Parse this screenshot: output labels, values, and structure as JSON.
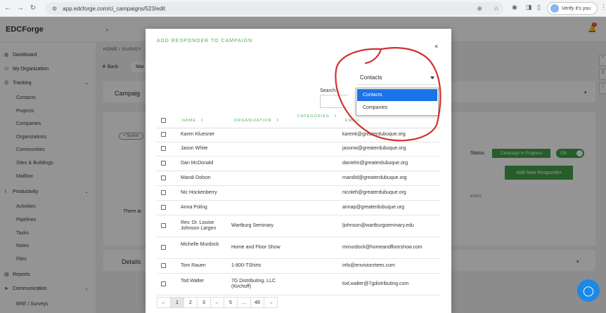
{
  "browser": {
    "url": "app.edcforge.com/ci_campaigns/523/edit",
    "verify_label": "Verify it's you"
  },
  "app": {
    "logo_main": "EDC",
    "logo_sub": "Forge",
    "notif_count": "3",
    "breadcrumb": "HOME / SURVEY",
    "back_label": "Back",
    "main_tab": "Mai",
    "campaign_title": "Campaig",
    "summary_label": "Summ",
    "status_label": "Status",
    "status_value": "Campaign In Progress",
    "toggle_label": "ON",
    "add_responder": "Add New Responder",
    "email_header": "EMAIL",
    "there_text": "There ar",
    "details_label": "Details"
  },
  "sidebar": {
    "dashboard": "Dashboard",
    "my_org": "My Organization",
    "tracking": "Tracking",
    "contacts": "Contacts",
    "projects": "Projects",
    "companies": "Companies",
    "organizations": "Organizations",
    "communities": "Communities",
    "sites": "Sites & Buildings",
    "mailbox": "Mailbox",
    "productivity": "Productivity",
    "activities": "Activities",
    "pipelines": "Pipelines",
    "tasks": "Tasks",
    "notes": "Notes",
    "files": "Files",
    "reports": "Reports",
    "communication": "Communication",
    "bre": "BRE / Surveys"
  },
  "modal": {
    "title": "ADD RESPONDER TO CAMPAIGN",
    "close": "×",
    "search_label": "Search:",
    "select_value": "Contacts",
    "options": [
      "Contacts",
      "Companies"
    ],
    "headers": {
      "name": "NAME",
      "organization": "ORGANIZATION",
      "categories": "CATEGORIES",
      "email": "EMAIL"
    },
    "rows": [
      {
        "name": "Karen Kluesner",
        "org": "",
        "email": "karenk@greaterdubuque.org"
      },
      {
        "name": "Jason White",
        "org": "",
        "email": "jasonw@greaterdubuque.org"
      },
      {
        "name": "Dan McDonald",
        "org": "",
        "email": "danielm@greaterdubuque.org"
      },
      {
        "name": "Mandi Dolson",
        "org": "",
        "email": "mandid@greaterdubuque.org"
      },
      {
        "name": "Nic Hockenberry",
        "org": "",
        "email": "nicoleh@greaterdubuque.org"
      },
      {
        "name": "Anna Poling",
        "org": "",
        "email": "annap@greaterdubuque.org"
      },
      {
        "name": "Rev. Dr. Louise Johnson Largen",
        "org": "Wartburg Seminary",
        "email": "ljohnson@wartburgseminary.edu"
      },
      {
        "name": "Michelle Murdock",
        "org": "Home and Floor Show",
        "email": "mmurdock@homeandfloorshow.com"
      },
      {
        "name": "Tom Rauen",
        "org": "1-800-TShirts",
        "email": "info@envisionrtees.com"
      },
      {
        "name": "Tod Walter",
        "org": "7G Distributing, LLC (Kirchoff)",
        "email": "tod.walter@7gdistributing.com"
      }
    ],
    "pager": {
      "prev": "←",
      "p1": "1",
      "p2": "2",
      "p3": "3",
      "ell1": "←",
      "p5": "5",
      "ell2": "…",
      "last": "48",
      "next": "→"
    }
  },
  "colors": {
    "accent_green": "#4caf50",
    "status_green": "#43a047",
    "highlight_blue": "#1a73e8",
    "annotation_red": "#d32f2f"
  }
}
